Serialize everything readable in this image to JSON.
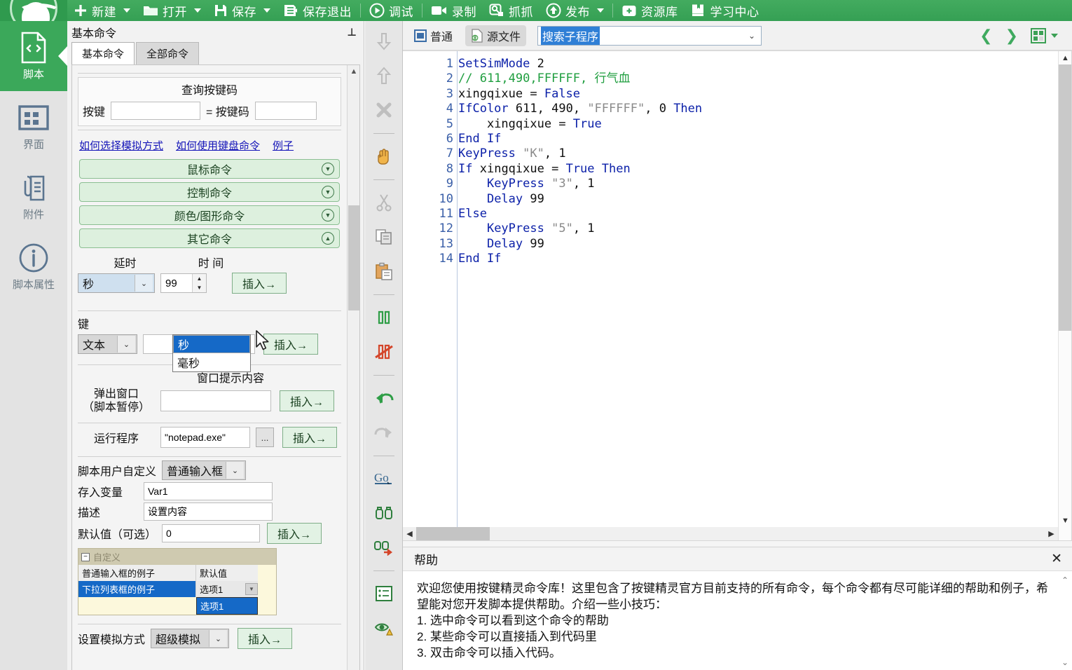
{
  "app": {
    "logo_name": "anjian-logo"
  },
  "toolbar": {
    "items": [
      {
        "label": "新建",
        "icon": "plus-icon",
        "caret": true
      },
      {
        "label": "打开",
        "icon": "folder-icon",
        "caret": true
      },
      {
        "label": "保存",
        "icon": "save-icon",
        "caret": true
      },
      {
        "label": "保存退出",
        "icon": "save-exit-icon",
        "caret": false
      },
      {
        "label": "调试",
        "icon": "play-icon",
        "caret": false
      },
      {
        "label": "录制",
        "icon": "video-camera-icon",
        "caret": false
      },
      {
        "label": "抓抓",
        "icon": "capture-icon",
        "caret": false
      },
      {
        "label": "发布",
        "icon": "upload-icon",
        "caret": true
      },
      {
        "label": "资源库",
        "icon": "toolbox-icon",
        "caret": false
      },
      {
        "label": "学习中心",
        "icon": "book-icon",
        "caret": false
      }
    ]
  },
  "rail": {
    "items": [
      {
        "label": "脚本",
        "icon": "script-file-icon",
        "active": true
      },
      {
        "label": "界面",
        "icon": "ui-grid-icon",
        "active": false
      },
      {
        "label": "附件",
        "icon": "attachment-icon",
        "active": false
      },
      {
        "label": "脚本属性",
        "icon": "info-circle-icon",
        "active": false
      }
    ]
  },
  "command_panel": {
    "title": "基本命令",
    "pin_icon": "pin-icon",
    "tabs": [
      {
        "label": "基本命令",
        "active": true
      },
      {
        "label": "全部命令",
        "active": false
      }
    ],
    "keycode": {
      "title": "查询按键码",
      "key_label": "按键",
      "key_value": "",
      "equals_label": "= 按键码",
      "code_value": ""
    },
    "links": [
      "如何选择模拟方式",
      "如何使用键盘命令",
      "例子"
    ],
    "groups": [
      {
        "label": "鼠标命令",
        "expanded": false,
        "chevron": "chevron-down-icon"
      },
      {
        "label": "控制命令",
        "expanded": false,
        "chevron": "chevron-down-icon"
      },
      {
        "label": "颜色/图形命令",
        "expanded": false,
        "chevron": "chevron-down-icon"
      },
      {
        "label": "其它命令",
        "expanded": true,
        "chevron": "chevron-up-icon"
      }
    ],
    "delay": {
      "col1_label": "延时",
      "col2_label": "时 间",
      "unit_selected": "秒",
      "time_value": "99",
      "insert_label": "插入→",
      "options": [
        "秒",
        "毫秒"
      ],
      "open": true
    },
    "keyboard_label": "键",
    "text_row": {
      "type_selected": "文本",
      "value": "",
      "insert_label": "插入→"
    },
    "popup_window": {
      "label_line1": "弹出窗口",
      "label_line2": "（脚本暂停）",
      "field_title": "窗口提示内容",
      "value": "",
      "insert_label": "插入→"
    },
    "run_program": {
      "label": "运行程序",
      "value": "\"notepad.exe\"",
      "browse_label": "...",
      "insert_label": "插入→"
    },
    "user_custom": {
      "label": "脚本用户自定义",
      "type_selected": "普通输入框",
      "var_label": "存入变量",
      "var_value": "Var1",
      "desc_label": "描述",
      "desc_value": "设置内容",
      "default_label": "默认值（可选）",
      "default_value": "0",
      "insert_label": "插入→",
      "grid": {
        "group_label": "自定义",
        "rows": [
          {
            "key": "普通输入框的例子",
            "value": "默认值",
            "selected": false
          },
          {
            "key": "下拉列表框的例子",
            "value": "选项1",
            "selected": true
          }
        ],
        "popup_option": "选项1"
      }
    },
    "sim_mode": {
      "label": "设置模拟方式",
      "value": "超级模拟",
      "insert_label": "插入→"
    }
  },
  "vertical_tools": [
    {
      "icon": "arrow-down-icon",
      "name": "move-down"
    },
    {
      "icon": "arrow-up-icon",
      "name": "move-up"
    },
    {
      "icon": "delete-x-icon",
      "name": "delete-line"
    },
    {
      "sep": true
    },
    {
      "icon": "hand-icon",
      "name": "drag-mode"
    },
    {
      "sep": true
    },
    {
      "icon": "scissors-icon",
      "name": "cut"
    },
    {
      "icon": "copy-icon",
      "name": "copy"
    },
    {
      "icon": "paste-icon",
      "name": "paste"
    },
    {
      "sep": true
    },
    {
      "icon": "pause-icon",
      "name": "comment-line"
    },
    {
      "icon": "uncomment-icon",
      "name": "uncomment-line"
    },
    {
      "sep": true
    },
    {
      "icon": "undo-icon",
      "name": "undo"
    },
    {
      "icon": "redo-icon",
      "name": "redo"
    },
    {
      "sep": true
    },
    {
      "icon": "goto-icon",
      "name": "goto-line"
    },
    {
      "icon": "find-icon",
      "name": "find"
    },
    {
      "icon": "find-replace-icon",
      "name": "find-replace"
    },
    {
      "sep": true
    },
    {
      "icon": "list-icon",
      "name": "outline"
    },
    {
      "icon": "eye-warning-icon",
      "name": "watch"
    }
  ],
  "editor": {
    "view_normal": "普通",
    "view_source": "源文件",
    "view_normal_icon": "window-icon",
    "view_source_icon": "source-file-icon",
    "search_value": "搜索子程序",
    "search_caret_icon": "chevron-down-icon",
    "prev_icon": "chevron-left-icon",
    "next_icon": "chevron-right-icon",
    "layout_icon": "layout-grid-icon",
    "code": [
      {
        "n": "1",
        "tokens": [
          [
            "kw",
            "SetSimMode"
          ],
          [
            "sp",
            " "
          ],
          [
            "num",
            "2"
          ]
        ]
      },
      {
        "n": "2",
        "tokens": [
          [
            "cmt",
            "// 611,490,FFFFFF, 行气血"
          ]
        ]
      },
      {
        "n": "3",
        "tokens": [
          [
            "id",
            "xingqixue"
          ],
          [
            "sp",
            " = "
          ],
          [
            "kw",
            "False"
          ]
        ]
      },
      {
        "n": "4",
        "tokens": [
          [
            "kw",
            "IfColor"
          ],
          [
            "sp",
            " "
          ],
          [
            "num",
            "611"
          ],
          [
            "sp",
            ", "
          ],
          [
            "num",
            "490"
          ],
          [
            "sp",
            ", "
          ],
          [
            "str",
            "\"FFFFFF\""
          ],
          [
            "sp",
            ", "
          ],
          [
            "num",
            "0"
          ],
          [
            "sp",
            " "
          ],
          [
            "kw",
            "Then"
          ]
        ]
      },
      {
        "n": "5",
        "tokens": [
          [
            "sp",
            "    "
          ],
          [
            "id",
            "xingqixue"
          ],
          [
            "sp",
            " = "
          ],
          [
            "kw",
            "True"
          ]
        ]
      },
      {
        "n": "6",
        "tokens": [
          [
            "kw",
            "End If"
          ]
        ]
      },
      {
        "n": "7",
        "tokens": [
          [
            "kw",
            "KeyPress"
          ],
          [
            "sp",
            " "
          ],
          [
            "str",
            "\"K\""
          ],
          [
            "sp",
            ", "
          ],
          [
            "num",
            "1"
          ]
        ]
      },
      {
        "n": "8",
        "tokens": [
          [
            "kw",
            "If"
          ],
          [
            "sp",
            " "
          ],
          [
            "id",
            "xingqixue"
          ],
          [
            "sp",
            " = "
          ],
          [
            "kw",
            "True"
          ],
          [
            "sp",
            " "
          ],
          [
            "kw",
            "Then"
          ]
        ]
      },
      {
        "n": "9",
        "tokens": [
          [
            "sp",
            "    "
          ],
          [
            "kw",
            "KeyPress"
          ],
          [
            "sp",
            " "
          ],
          [
            "str",
            "\"3\""
          ],
          [
            "sp",
            ", "
          ],
          [
            "num",
            "1"
          ]
        ]
      },
      {
        "n": "10",
        "tokens": [
          [
            "sp",
            "    "
          ],
          [
            "kw",
            "Delay"
          ],
          [
            "sp",
            " "
          ],
          [
            "num",
            "99"
          ]
        ]
      },
      {
        "n": "11",
        "tokens": [
          [
            "kw",
            "Else"
          ]
        ]
      },
      {
        "n": "12",
        "tokens": [
          [
            "sp",
            "    "
          ],
          [
            "kw",
            "KeyPress"
          ],
          [
            "sp",
            " "
          ],
          [
            "str",
            "\"5\""
          ],
          [
            "sp",
            ", "
          ],
          [
            "num",
            "1"
          ]
        ]
      },
      {
        "n": "13",
        "tokens": [
          [
            "sp",
            "    "
          ],
          [
            "kw",
            "Delay"
          ],
          [
            "sp",
            " "
          ],
          [
            "num",
            "99"
          ]
        ]
      },
      {
        "n": "14",
        "tokens": [
          [
            "kw",
            "End If"
          ]
        ]
      }
    ]
  },
  "help": {
    "title": "帮助",
    "close_label": "✕",
    "paragraphs": [
      "欢迎您使用按键精灵命令库！这里包含了按键精灵官方目前支持的所有命令，每个命令都有尽可能详细的帮助和例子，希望能对您开发脚本提供帮助。介绍一些小技巧：",
      "1. 选中命令可以看到这个命令的帮助",
      "2. 某些命令可以直接插入到代码里",
      "3. 双击命令可以插入代码。"
    ]
  },
  "colors": {
    "brand_green": "#3ba85a",
    "group_green": "#ddf0de",
    "select_blue": "#1569c7",
    "link_blue": "#1414b8"
  }
}
